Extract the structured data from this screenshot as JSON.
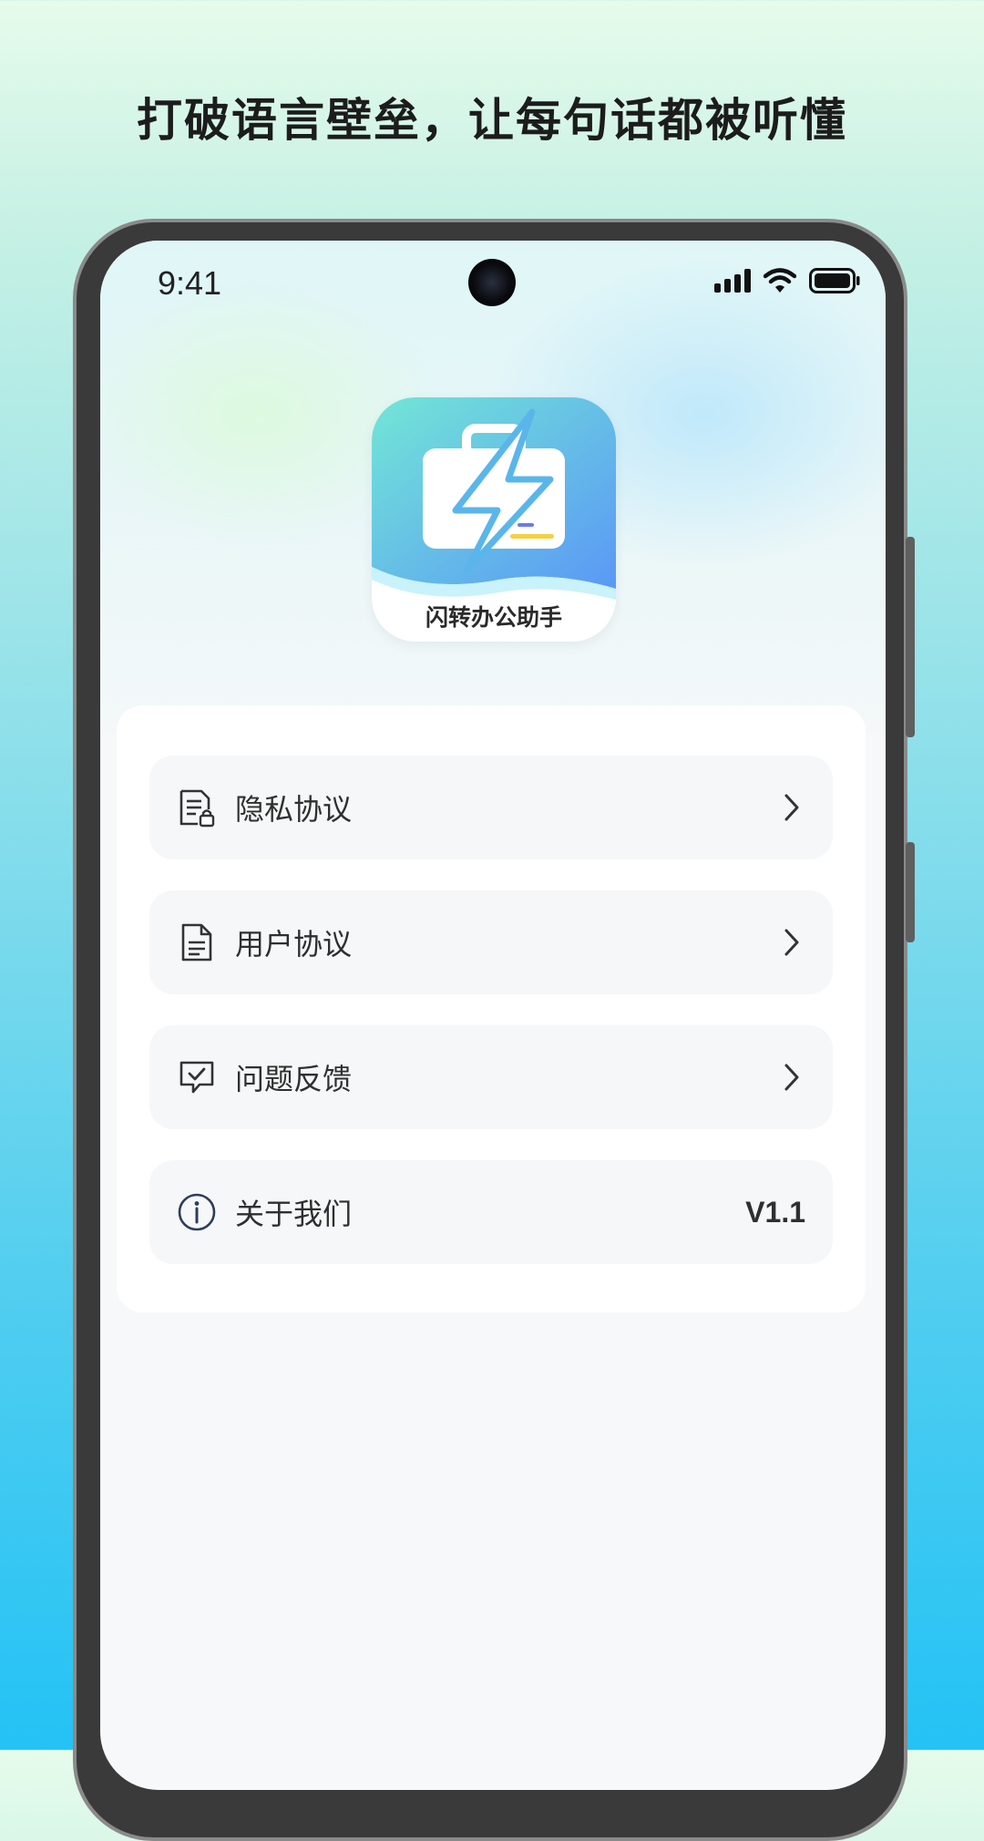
{
  "headline": "打破语言壁垒，让每句话都被听懂",
  "status_bar": {
    "time": "9:41",
    "icons": [
      "signal-icon",
      "wifi-icon",
      "battery-icon"
    ]
  },
  "app": {
    "name": "闪转办公助手",
    "icon": "lightning-briefcase-icon"
  },
  "menu": [
    {
      "label": "隐私协议",
      "icon": "privacy-document-icon",
      "trailing": "chevron-right-icon"
    },
    {
      "label": "用户协议",
      "icon": "document-icon",
      "trailing": "chevron-right-icon"
    },
    {
      "label": "问题反馈",
      "icon": "feedback-message-icon",
      "trailing": "chevron-right-icon"
    },
    {
      "label": "关于我们",
      "icon": "info-icon",
      "trailing_text": "V1.1"
    }
  ],
  "colors": {
    "accent_gradient_start": "#6fe3d8",
    "accent_gradient_end": "#5a9ef6",
    "text": "#2f2f2f",
    "row_background": "#f6f7f8"
  }
}
